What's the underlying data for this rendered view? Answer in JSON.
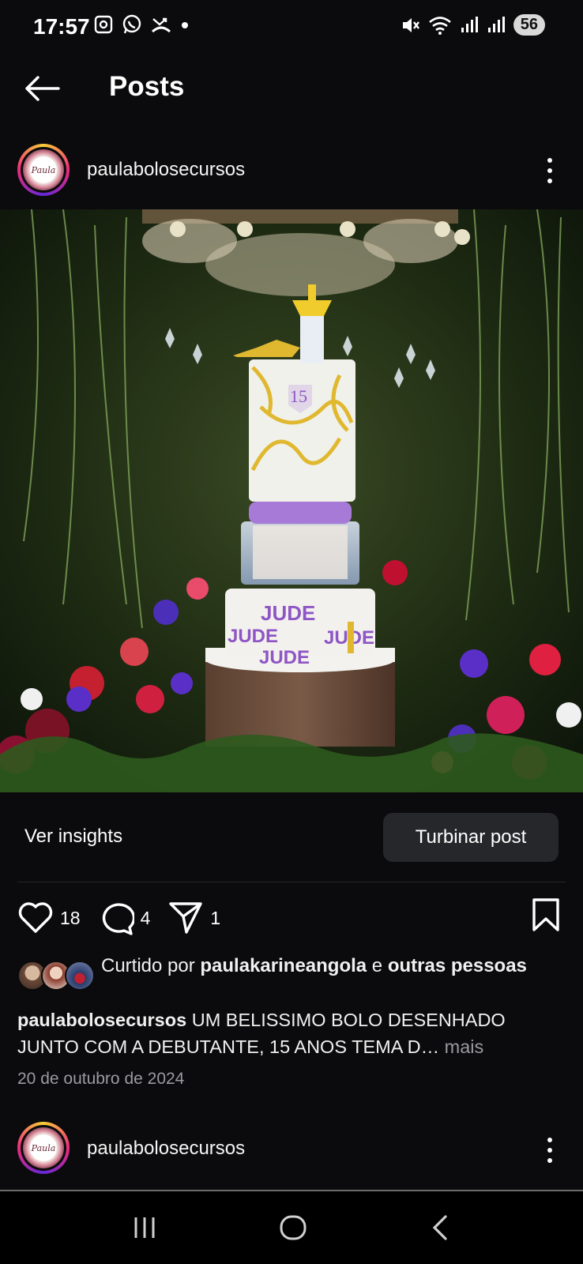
{
  "status_bar": {
    "time": "17:57",
    "left_icons": [
      "screenshot-icon",
      "whatsapp-icon",
      "missed-call-icon",
      "dot-icon"
    ],
    "right_icons": [
      "mute-icon",
      "wifi-icon",
      "signal-icon",
      "signal-icon"
    ],
    "battery": "56"
  },
  "header": {
    "title": "Posts"
  },
  "post": {
    "username": "paulabolosecursos",
    "avatar_text": "Paula",
    "cake_text": [
      "15",
      "JUDE"
    ],
    "insights_label": "Ver insights",
    "boost_label": "Turbinar post",
    "likes": "18",
    "comments": "4",
    "shares": "1",
    "liked_by_prefix": "Curtido por ",
    "liked_by_user": "paulakarineangola",
    "liked_by_conj": " e ",
    "liked_by_others": "outras pessoas",
    "caption_user": "paulabolosecursos",
    "caption_text": " UM BELISSIMO BOLO DESENHADO JUNTO COM A DEBUTANTE, 15 ANOS TEMA D…",
    "more_label": " mais",
    "date": "20 de outubro de 2024"
  },
  "next_post": {
    "username": "paulabolosecursos",
    "avatar_text": "Paula"
  },
  "colors": {
    "background": "#0b0b0d",
    "button": "#26272b",
    "secondary_text": "#9a9aa0"
  }
}
